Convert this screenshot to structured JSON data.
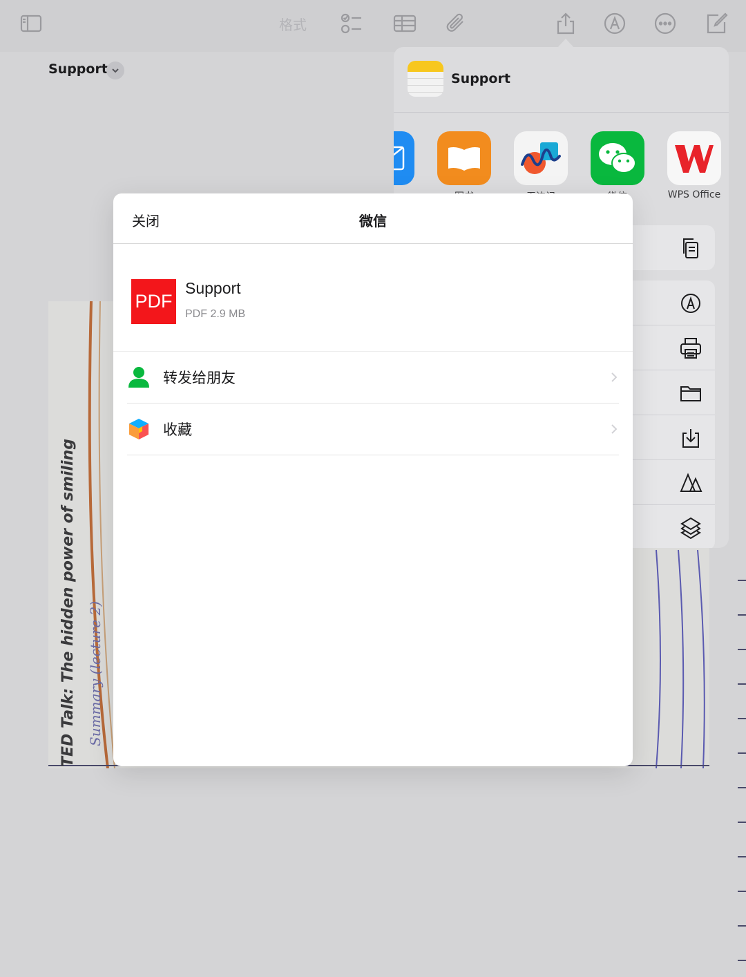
{
  "toolbar": {
    "format_label": "格式"
  },
  "note": {
    "title": "Support"
  },
  "paper": {
    "printed_title": "TED Talk: The hidden power of smiling",
    "handwritten": "Summary (lecture 2)"
  },
  "share_sheet": {
    "title": "Support",
    "apps": [
      {
        "name": "mail-app",
        "label": ""
      },
      {
        "name": "books-app",
        "label": "图书"
      },
      {
        "name": "freeform-app",
        "label": "无边记"
      },
      {
        "name": "wechat-app",
        "label": "微信"
      },
      {
        "name": "wps-office-app",
        "label": "WPS Office"
      }
    ],
    "actions": [
      {
        "name": "copy-action",
        "icon": "copy-icon"
      },
      {
        "name": "markup-action",
        "icon": "markup-icon"
      },
      {
        "name": "print-action",
        "icon": "printer-icon"
      },
      {
        "name": "save-to-files-action",
        "icon": "folder-icon"
      },
      {
        "name": "save-action",
        "icon": "download-tray-icon"
      },
      {
        "name": "translate-action",
        "icon": "translate-icon"
      },
      {
        "name": "shortcuts-action",
        "icon": "shortcuts-icon"
      }
    ]
  },
  "modal": {
    "close_label": "关闭",
    "title": "微信",
    "file": {
      "badge": "PDF",
      "name": "Support",
      "meta": "PDF 2.9 MB"
    },
    "options": [
      {
        "label": "转发给朋友",
        "icon": "person-icon",
        "color": "#09b83e"
      },
      {
        "label": "收藏",
        "icon": "cube-icon",
        "color": "#fa9d3b"
      }
    ]
  },
  "colors": {
    "pdf_red": "#f3161b",
    "wechat_green": "#09b83e",
    "books_orange": "#f28c1e",
    "wps_red": "#e8232a"
  }
}
